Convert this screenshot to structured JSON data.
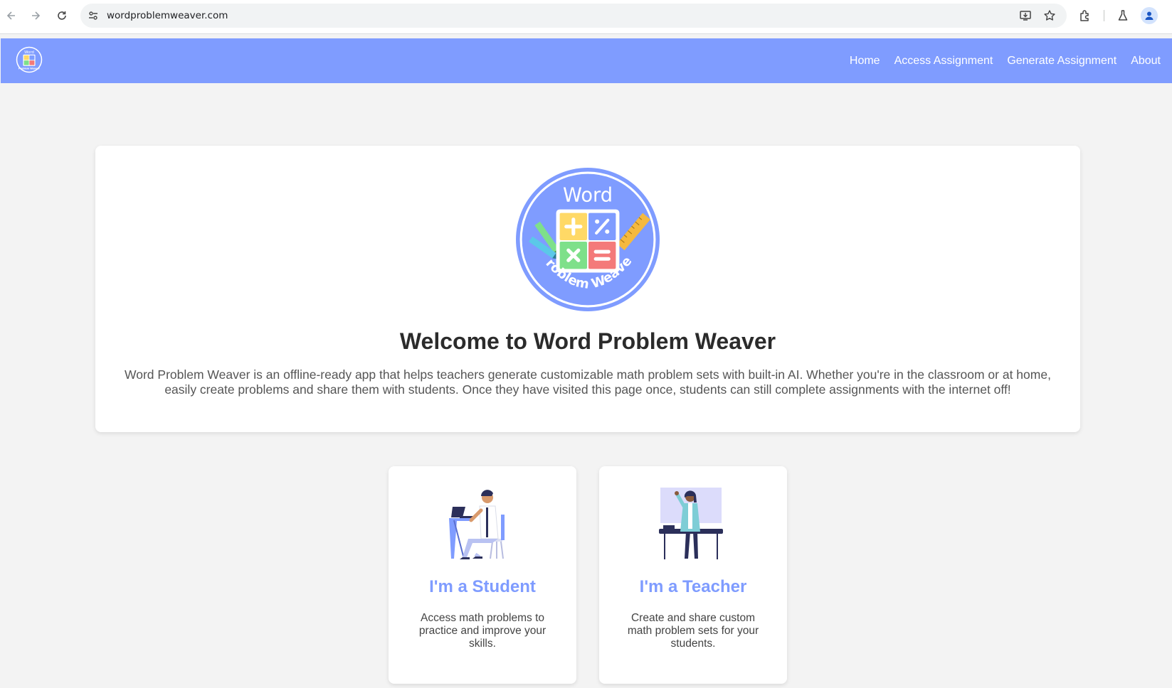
{
  "browser": {
    "url": "wordproblemweaver.com"
  },
  "nav": {
    "logo_text_top": "Word",
    "logo_text_bottom": "Problem Weaver",
    "links": [
      "Home",
      "Access Assignment",
      "Generate Assignment",
      "About"
    ]
  },
  "welcome": {
    "logo_text_top": "Word",
    "logo_text_bottom": "Problem Weaver",
    "title": "Welcome to Word Problem Weaver",
    "description": "Word Problem Weaver is an offline-ready app that helps teachers generate customizable math problem sets with built-in AI. Whether you're in the classroom or at home, easily create problems and share them with students. Once they have visited this page once, students can still complete assignments with the internet off!"
  },
  "roles": [
    {
      "title": "I'm a Student",
      "description": "Access math problems to practice and improve your skills."
    },
    {
      "title": "I'm a Teacher",
      "description": "Create and share custom math problem sets for your students."
    }
  ],
  "colors": {
    "brand": "#7f9cff",
    "tile_yellow": "#ffd966",
    "tile_blue": "#7f9cff",
    "tile_green": "#7ee08a",
    "tile_red": "#f47a7a"
  }
}
